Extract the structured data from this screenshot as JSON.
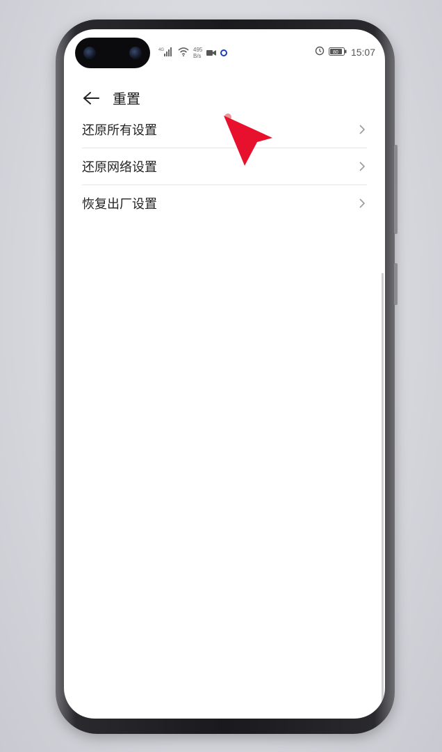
{
  "status_bar": {
    "signal": "4G",
    "net_speed_value": "495",
    "net_speed_unit": "B/s",
    "time": "15:07",
    "battery": "80"
  },
  "header": {
    "title": "重置"
  },
  "menu": {
    "items": [
      {
        "label": "还原所有设置"
      },
      {
        "label": "还原网络设置"
      },
      {
        "label": "恢复出厂设置"
      }
    ]
  },
  "colors": {
    "pointer": "#e8112d",
    "divider": "#e6e6e6"
  }
}
